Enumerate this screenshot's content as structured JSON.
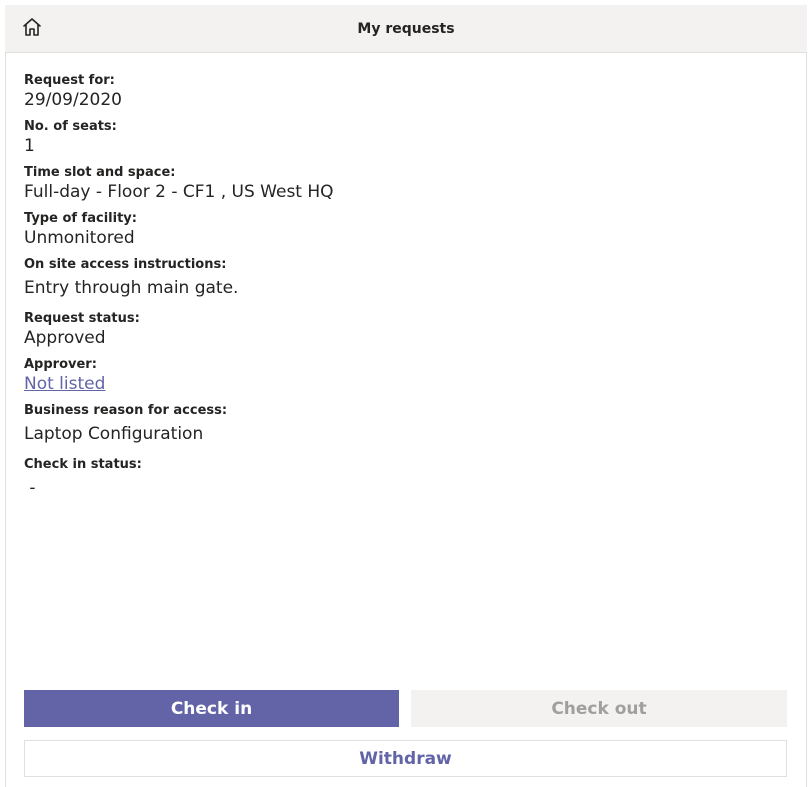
{
  "header": {
    "title": "My requests",
    "home_icon": "home-icon"
  },
  "details": [
    {
      "label": "Request for:",
      "value": "29/09/2020"
    },
    {
      "label": "No. of seats:",
      "value": "1"
    },
    {
      "label": "Time slot and space:",
      "value": "Full-day - Floor 2 - CF1 , US West HQ"
    },
    {
      "label": "Type of facility:",
      "value": "Unmonitored"
    },
    {
      "label": "On site access instructions:",
      "value": "Entry through main gate."
    },
    {
      "label": "Request status:",
      "value": "Approved"
    },
    {
      "label": "Approver:",
      "value": "Not listed"
    },
    {
      "label": "Business reason for access:",
      "value": "Laptop Configuration"
    },
    {
      "label": "Check in status:",
      "value": " -"
    }
  ],
  "actions": {
    "check_in": "Check in",
    "check_out": "Check out",
    "withdraw": "Withdraw"
  },
  "colors": {
    "accent": "#6264a7",
    "header_bg": "#f3f2f1",
    "disabled_text": "#a19f9d"
  }
}
